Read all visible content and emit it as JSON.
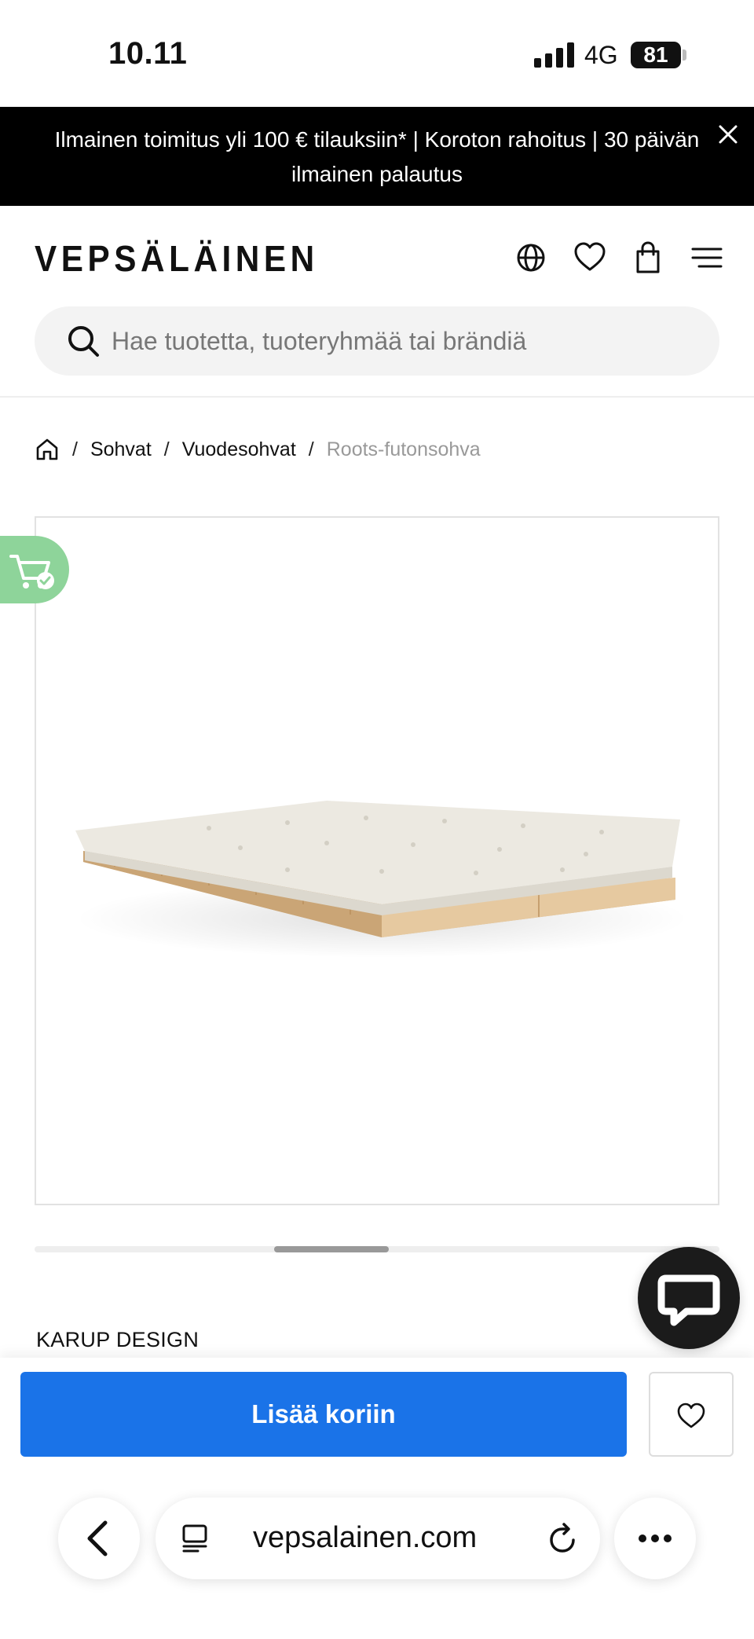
{
  "status_bar": {
    "time": "10.11",
    "network": "4G",
    "battery": "81"
  },
  "promo": {
    "text": "Ilmainen toimitus yli 100 € tilauksiin* | Koroton rahoitus | 30 päivän ilmainen palautus"
  },
  "header": {
    "logo": "VEPSÄLÄINEN",
    "icons": [
      "globe-icon",
      "heart-icon",
      "shopping-bag-icon",
      "menu-icon"
    ],
    "search": {
      "placeholder": "Hae tuotetta, tuoteryhmää tai brändiä",
      "value": ""
    }
  },
  "breadcrumb": {
    "items": [
      "Sohvat",
      "Vuodesohvat"
    ],
    "current": "Roots-futonsohva",
    "separator": "/"
  },
  "product": {
    "brand": "KARUP DESIGN",
    "gallery_position": 0.42
  },
  "cta": {
    "add_to_cart": "Lisää koriin"
  },
  "browser": {
    "url": "vepsalainen.com"
  },
  "colors": {
    "primary": "#1a73e8",
    "promo_bg": "#000000",
    "cart_badge": "#8ed49a"
  }
}
